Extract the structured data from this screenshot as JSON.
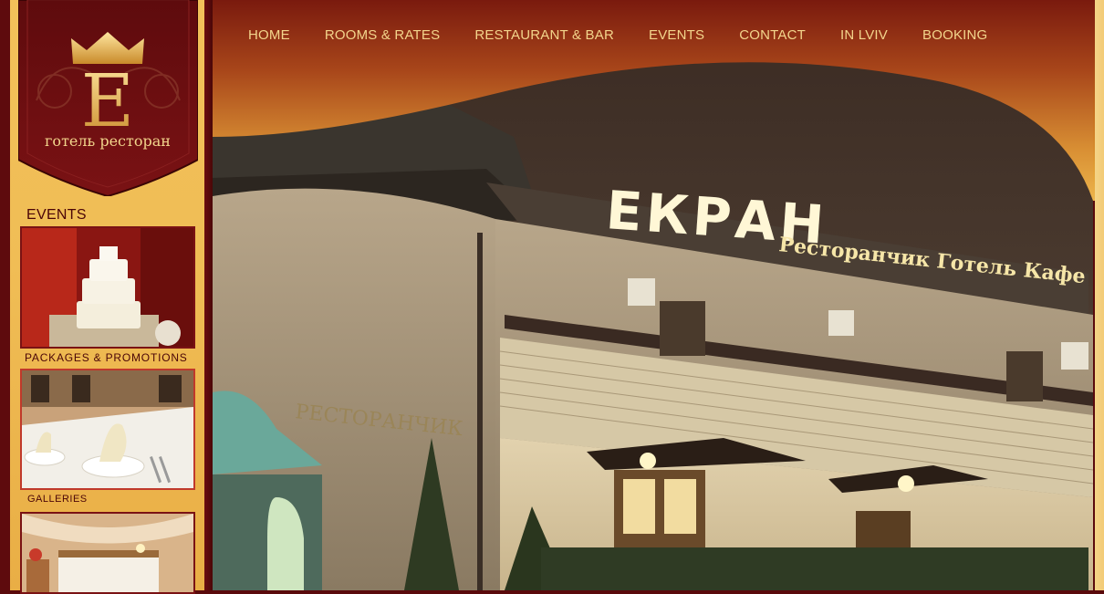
{
  "logo": {
    "letter": "E",
    "subtitle": "готель ресторан"
  },
  "nav": {
    "items": [
      {
        "label": "HOME"
      },
      {
        "label": "ROOMS & RATES"
      },
      {
        "label": "RESTAURANT & BAR"
      },
      {
        "label": "EVENTS"
      },
      {
        "label": "CONTACT"
      },
      {
        "label": "IN LVIV"
      },
      {
        "label": "BOOKING"
      }
    ]
  },
  "sidebar": {
    "events_label": "EVENTS",
    "promo_label": "PACKAGES & PROMOTIONS",
    "galleries_label": "GALLERIES"
  },
  "hero": {
    "sign_main": "ЕКРАН",
    "sign_sub": "Ресторанчик  Готель  Кафе",
    "wall_sign": "РЕСТОРАНЧИК"
  },
  "colors": {
    "maroon": "#5a0a0c",
    "gold": "#f0bd55",
    "nav_text": "#f3d58c"
  }
}
